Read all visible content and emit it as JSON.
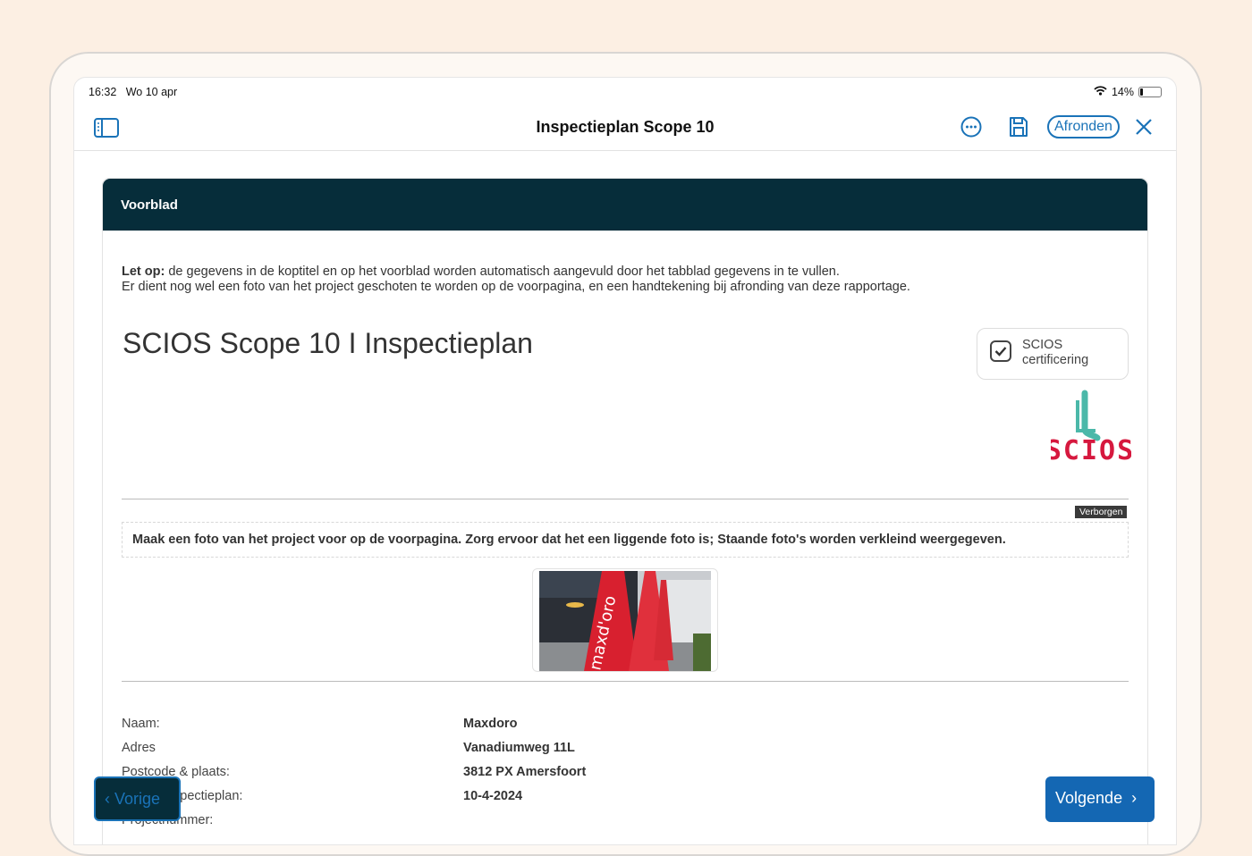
{
  "status": {
    "time": "16:32",
    "date": "Wo 10 apr",
    "battery": "14%"
  },
  "nav": {
    "title": "Inspectieplan Scope 10",
    "finish_label": "Afronden"
  },
  "section": {
    "title": "Voorblad"
  },
  "note": {
    "bold": "Let op:",
    "line1": " de gegevens in de koptitel en op het voorblad worden automatisch aangevuld door het tabblad gegevens in te vullen.",
    "line2": "Er dient nog wel een foto van het project geschoten te worden op de voorpagina, en een handtekening bij afronding van deze rapportage."
  },
  "doc_title": "SCIOS Scope 10 I Inspectieplan",
  "certificate": {
    "label": "SCIOS certificering",
    "checked": true
  },
  "logo_text": "SCIOS",
  "hidden_badge": "Verborgen",
  "photo_instruction": "Maak een foto van het project voor op de voorpagina. Zorg ervoor dat het een liggende foto is; Staande foto's worden verkleind weergegeven.",
  "photo_text": "maxd'oro",
  "fields": [
    {
      "label": "Naam:",
      "value": "Maxdoro"
    },
    {
      "label": "Adres",
      "value": "Vanadiumweg 11L"
    },
    {
      "label": "Postcode & plaats:",
      "value": "3812 PX Amersfoort"
    },
    {
      "label": "Datum inspectieplan:",
      "value": "10-4-2024"
    },
    {
      "label": "Projectnummer:",
      "value": ""
    }
  ],
  "buttons": {
    "prev": "Vorige",
    "next": "Volgende"
  }
}
